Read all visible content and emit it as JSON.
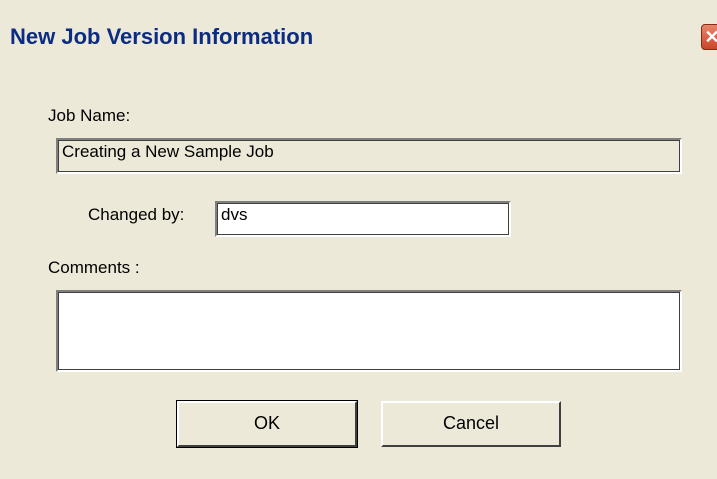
{
  "window": {
    "title": "New Job Version Information",
    "close_glyph": "✕"
  },
  "form": {
    "job_name_label": "Job Name:",
    "job_name_value": "Creating a New Sample Job",
    "changed_by_label": "Changed by:",
    "changed_by_value": "dvs",
    "comments_label": "Comments :",
    "comments_value": ""
  },
  "buttons": {
    "ok_label": "OK",
    "cancel_label": "Cancel"
  },
  "icons": {
    "close": "close-icon"
  }
}
